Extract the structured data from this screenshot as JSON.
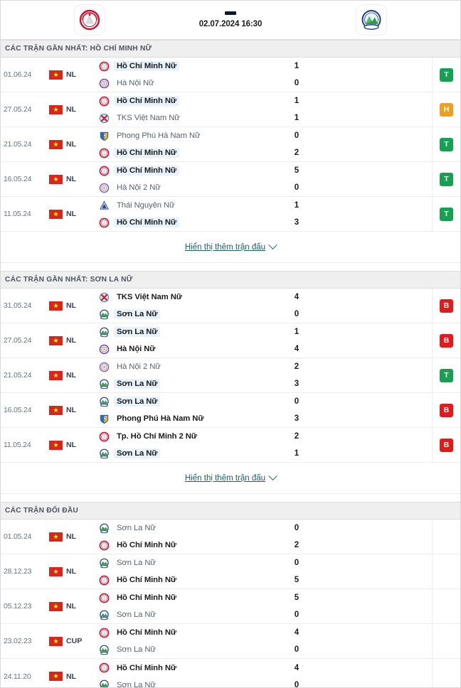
{
  "header": {
    "home_team": "Hồ Chí Minh Nữ",
    "away_team": "Sơn La Nữ",
    "home_logo": "hcm-crest",
    "away_logo": "sonla-crest",
    "score_separator": "-",
    "kickoff": "02.07.2024 16:30"
  },
  "show_more_label": "Hiển thị thêm trận đấu",
  "flag_star": "★",
  "colors": {
    "win": "#18a052",
    "draw": "#f0a020",
    "loss": "#e01b1b",
    "link": "#16616b",
    "highlight_bg": "#e8f2fb"
  },
  "sections": [
    {
      "title": "CÁC TRẬN GẦN NHẤT: HỒ CHÍ MINH NỮ",
      "has_show_more": true,
      "matches": [
        {
          "date": "01.06.24",
          "competition": "NL",
          "home": {
            "name": "Hồ Chí Minh Nữ",
            "logo": "hcm-crest",
            "score": "1",
            "highlight": true,
            "winner": true
          },
          "away": {
            "name": "Hà Nội Nữ",
            "logo": "hanoi-crest",
            "score": "0",
            "highlight": false,
            "winner": false
          },
          "result": "T"
        },
        {
          "date": "27.05.24",
          "competition": "NL",
          "home": {
            "name": "Hồ Chí Minh Nữ",
            "logo": "hcm-crest",
            "score": "1",
            "highlight": true,
            "winner": false
          },
          "away": {
            "name": "TKS Việt Nam Nữ",
            "logo": "tks-crest",
            "score": "1",
            "highlight": false,
            "winner": false
          },
          "result": "H"
        },
        {
          "date": "21.05.24",
          "competition": "NL",
          "home": {
            "name": "Phong Phú Hà Nam Nữ",
            "logo": "phongphu-shield",
            "score": "0",
            "highlight": false,
            "winner": false
          },
          "away": {
            "name": "Hồ Chí Minh Nữ",
            "logo": "hcm-crest",
            "score": "2",
            "highlight": true,
            "winner": true
          },
          "result": "T"
        },
        {
          "date": "16.05.24",
          "competition": "NL",
          "home": {
            "name": "Hồ Chí Minh Nữ",
            "logo": "hcm-crest",
            "score": "5",
            "highlight": true,
            "winner": true
          },
          "away": {
            "name": "Hà Nội 2 Nữ",
            "logo": "hanoi2-crest",
            "score": "0",
            "highlight": false,
            "winner": false
          },
          "result": "T"
        },
        {
          "date": "11.05.24",
          "competition": "NL",
          "home": {
            "name": "Thái Nguyên Nữ",
            "logo": "thainguyen-crest",
            "score": "1",
            "highlight": false,
            "winner": false
          },
          "away": {
            "name": "Hồ Chí Minh Nữ",
            "logo": "hcm-crest",
            "score": "3",
            "highlight": true,
            "winner": true
          },
          "result": "T"
        }
      ]
    },
    {
      "title": "CÁC TRẬN GẦN NHẤT: SƠN LA NỮ",
      "has_show_more": true,
      "matches": [
        {
          "date": "31.05.24",
          "competition": "NL",
          "home": {
            "name": "TKS Việt Nam Nữ",
            "logo": "tks-crest",
            "score": "4",
            "highlight": false,
            "winner": true
          },
          "away": {
            "name": "Sơn La Nữ",
            "logo": "sonla-crest",
            "score": "0",
            "highlight": true,
            "winner": false
          },
          "result": "B"
        },
        {
          "date": "27.05.24",
          "competition": "NL",
          "home": {
            "name": "Sơn La Nữ",
            "logo": "sonla-crest",
            "score": "1",
            "highlight": true,
            "winner": false
          },
          "away": {
            "name": "Hà Nội Nữ",
            "logo": "hanoi-crest",
            "score": "4",
            "highlight": false,
            "winner": true
          },
          "result": "B"
        },
        {
          "date": "21.05.24",
          "competition": "NL",
          "home": {
            "name": "Hà Nội 2 Nữ",
            "logo": "hanoi2-crest",
            "score": "2",
            "highlight": false,
            "winner": false
          },
          "away": {
            "name": "Sơn La Nữ",
            "logo": "sonla-crest",
            "score": "3",
            "highlight": true,
            "winner": true
          },
          "result": "T"
        },
        {
          "date": "16.05.24",
          "competition": "NL",
          "home": {
            "name": "Sơn La Nữ",
            "logo": "sonla-crest",
            "score": "0",
            "highlight": true,
            "winner": false
          },
          "away": {
            "name": "Phong Phú Hà Nam Nữ",
            "logo": "phongphu-shield",
            "score": "3",
            "highlight": false,
            "winner": true
          },
          "result": "B"
        },
        {
          "date": "11.05.24",
          "competition": "NL",
          "home": {
            "name": "Tp. Hồ Chí Minh 2 Nữ",
            "logo": "hcm-crest",
            "score": "2",
            "highlight": false,
            "winner": true
          },
          "away": {
            "name": "Sơn La Nữ",
            "logo": "sonla-crest",
            "score": "1",
            "highlight": true,
            "winner": false
          },
          "result": "B"
        }
      ]
    },
    {
      "title": "CÁC TRẬN ĐỐI ĐẦU",
      "has_show_more": false,
      "matches": [
        {
          "date": "01.05.24",
          "competition": "NL",
          "home": {
            "name": "Sơn La Nữ",
            "logo": "sonla-crest",
            "score": "0",
            "highlight": false,
            "winner": false
          },
          "away": {
            "name": "Hồ Chí Minh Nữ",
            "logo": "hcm-crest",
            "score": "2",
            "highlight": false,
            "winner": true
          },
          "result": ""
        },
        {
          "date": "28.12.23",
          "competition": "NL",
          "home": {
            "name": "Sơn La Nữ",
            "logo": "sonla-crest",
            "score": "0",
            "highlight": false,
            "winner": false
          },
          "away": {
            "name": "Hồ Chí Minh Nữ",
            "logo": "hcm-crest",
            "score": "5",
            "highlight": false,
            "winner": true
          },
          "result": ""
        },
        {
          "date": "05.12.23",
          "competition": "NL",
          "home": {
            "name": "Hồ Chí Minh Nữ",
            "logo": "hcm-crest",
            "score": "5",
            "highlight": false,
            "winner": true
          },
          "away": {
            "name": "Sơn La Nữ",
            "logo": "sonla-crest",
            "score": "0",
            "highlight": false,
            "winner": false
          },
          "result": ""
        },
        {
          "date": "23.02.23",
          "competition": "CUP",
          "home": {
            "name": "Hồ Chí Minh Nữ",
            "logo": "hcm-crest",
            "score": "4",
            "highlight": false,
            "winner": true
          },
          "away": {
            "name": "Sơn La Nữ",
            "logo": "sonla-crest",
            "score": "0",
            "highlight": false,
            "winner": false
          },
          "result": ""
        },
        {
          "date": "24.11.20",
          "competition": "NL",
          "home": {
            "name": "Hồ Chí Minh Nữ",
            "logo": "hcm-crest",
            "score": "4",
            "highlight": false,
            "winner": true
          },
          "away": {
            "name": "Sơn La Nữ",
            "logo": "sonla-crest",
            "score": "0",
            "highlight": false,
            "winner": false
          },
          "result": ""
        }
      ]
    }
  ]
}
